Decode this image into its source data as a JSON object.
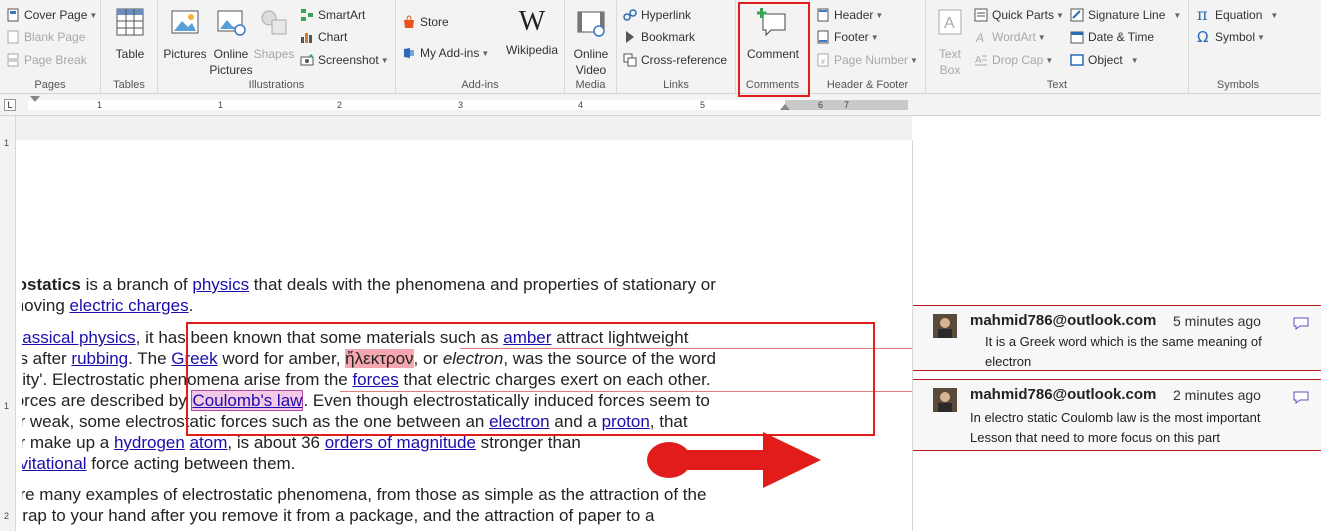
{
  "ribbon": {
    "pages": {
      "label": "Pages",
      "cover_page": "Cover Page",
      "blank_page": "Blank Page",
      "page_break": "Page Break"
    },
    "tables": {
      "label": "Tables",
      "table": "Table"
    },
    "illustrations": {
      "label": "Illustrations",
      "pictures": "Pictures",
      "online_pictures": "Online Pictures",
      "shapes": "Shapes",
      "smartart": "SmartArt",
      "chart": "Chart",
      "screenshot": "Screenshot"
    },
    "addins": {
      "label": "Add-ins",
      "store": "Store",
      "my_addins": "My Add-ins",
      "wikipedia": "Wikipedia"
    },
    "media": {
      "label": "Media",
      "online_video": "Online Video"
    },
    "links": {
      "label": "Links",
      "hyperlink": "Hyperlink",
      "bookmark": "Bookmark",
      "cross_reference": "Cross-reference"
    },
    "comments": {
      "label": "Comments",
      "comment": "Comment"
    },
    "header_footer": {
      "label": "Header & Footer",
      "header": "Header",
      "footer": "Footer",
      "page_number": "Page Number"
    },
    "text": {
      "label": "Text",
      "text_box": "Text Box",
      "quick_parts": "Quick Parts",
      "wordart": "WordArt",
      "drop_cap": "Drop Cap",
      "signature_line": "Signature Line",
      "date_time": "Date & Time",
      "object": "Object"
    },
    "symbols": {
      "label": "Symbols",
      "equation": "Equation",
      "symbol": "Symbol"
    }
  },
  "ruler": {
    "numbers": [
      "1",
      "1",
      "2",
      "3",
      "4",
      "5",
      "6",
      "7"
    ],
    "vnumbers": [
      "1",
      "1",
      "2"
    ]
  },
  "document": {
    "p1": {
      "a": "rostatics",
      "b": " is a branch of ",
      "physics": "physics",
      "c": " that deals with the phenomena and properties of stationary or",
      "d": "moving ",
      "electric_charges": "electric charges",
      "e": "."
    },
    "p2": {
      "classical_physics": "classical physics",
      "a": ", it has been known that some materials such as ",
      "amber": "amber",
      "b": " attract lightweight",
      "c": "es after ",
      "rubbing": "rubbing",
      "d": ". The ",
      "greek": "Greek",
      "e": " word for amber, ",
      "elektron": "ἤλεκτρον",
      "f": ", or ",
      "electron_it": "electron",
      "g": ", was the source of the word",
      "h": "icity'. Electrostatic phenomena arise from the ",
      "forces": "forces",
      "i": " that electric charges exert on each other.",
      "j": "forces are described by ",
      "coulomb": "Coulomb's law",
      "k": ". Even though electrostatically induced forces seem to",
      "l": "er weak, some electrostatic forces such as the one between an ",
      "electron": "electron",
      "m": " and a ",
      "proton": "proton",
      "n": ", that",
      "o": "er make up a ",
      "hydrogen": "hydrogen",
      "atom": "atom",
      "p": ", is about 36 ",
      "orders": "orders of magnitude",
      "q": " stronger than",
      "gravitational": "avitational",
      "r": " force acting between them."
    },
    "p3": {
      "a": "are many examples of electrostatic phenomena, from those as simple as the attraction of the",
      "b": "wrap to your hand after you remove it from a package, and the attraction of paper to a"
    }
  },
  "comments": [
    {
      "author": "mahmid786@outlook.com",
      "time": "5 minutes ago",
      "text": "It is a Greek word which is the same meaning of electron"
    },
    {
      "author": "mahmid786@outlook.com",
      "time": "2 minutes ago",
      "text": "In electro static Coulomb law is the most important Lesson that need to more focus on this part"
    }
  ],
  "colors": {
    "annotation_red": "#e21b1b",
    "link_blue": "#1a0dab",
    "highlight_pink": "#f4a7b0",
    "comment_highlight": "#f4c9e6"
  }
}
